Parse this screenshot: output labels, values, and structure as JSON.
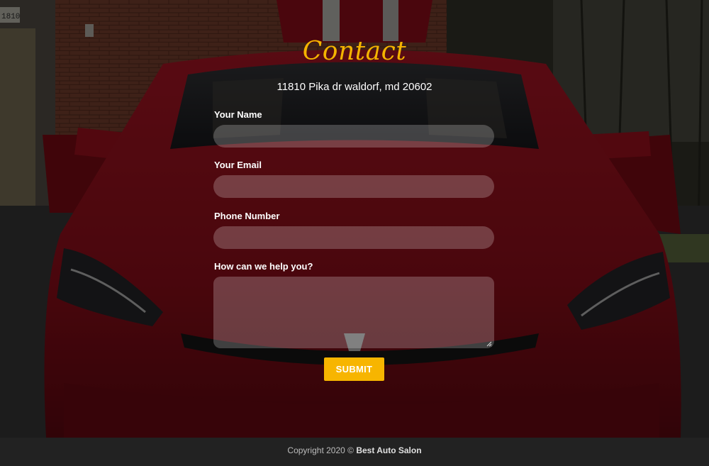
{
  "contact": {
    "title": "Contact",
    "address": "11810 Pika dr waldorf, md 20602",
    "fields": {
      "name_label": "Your Name",
      "name_value": "",
      "email_label": "Your Email",
      "email_value": "",
      "phone_label": "Phone Number",
      "phone_value": "",
      "message_label": "How can we help you?",
      "message_value": ""
    },
    "submit_label": "SUBMIT"
  },
  "background": {
    "house_number": "1810"
  },
  "footer": {
    "copyright_prefix": "Copyright 2020 ©",
    "company": "Best Auto Salon"
  },
  "colors": {
    "accent": "#f5b400",
    "button": "#f7b500",
    "footer_bg": "#222222",
    "car_red": "#a8101c"
  }
}
